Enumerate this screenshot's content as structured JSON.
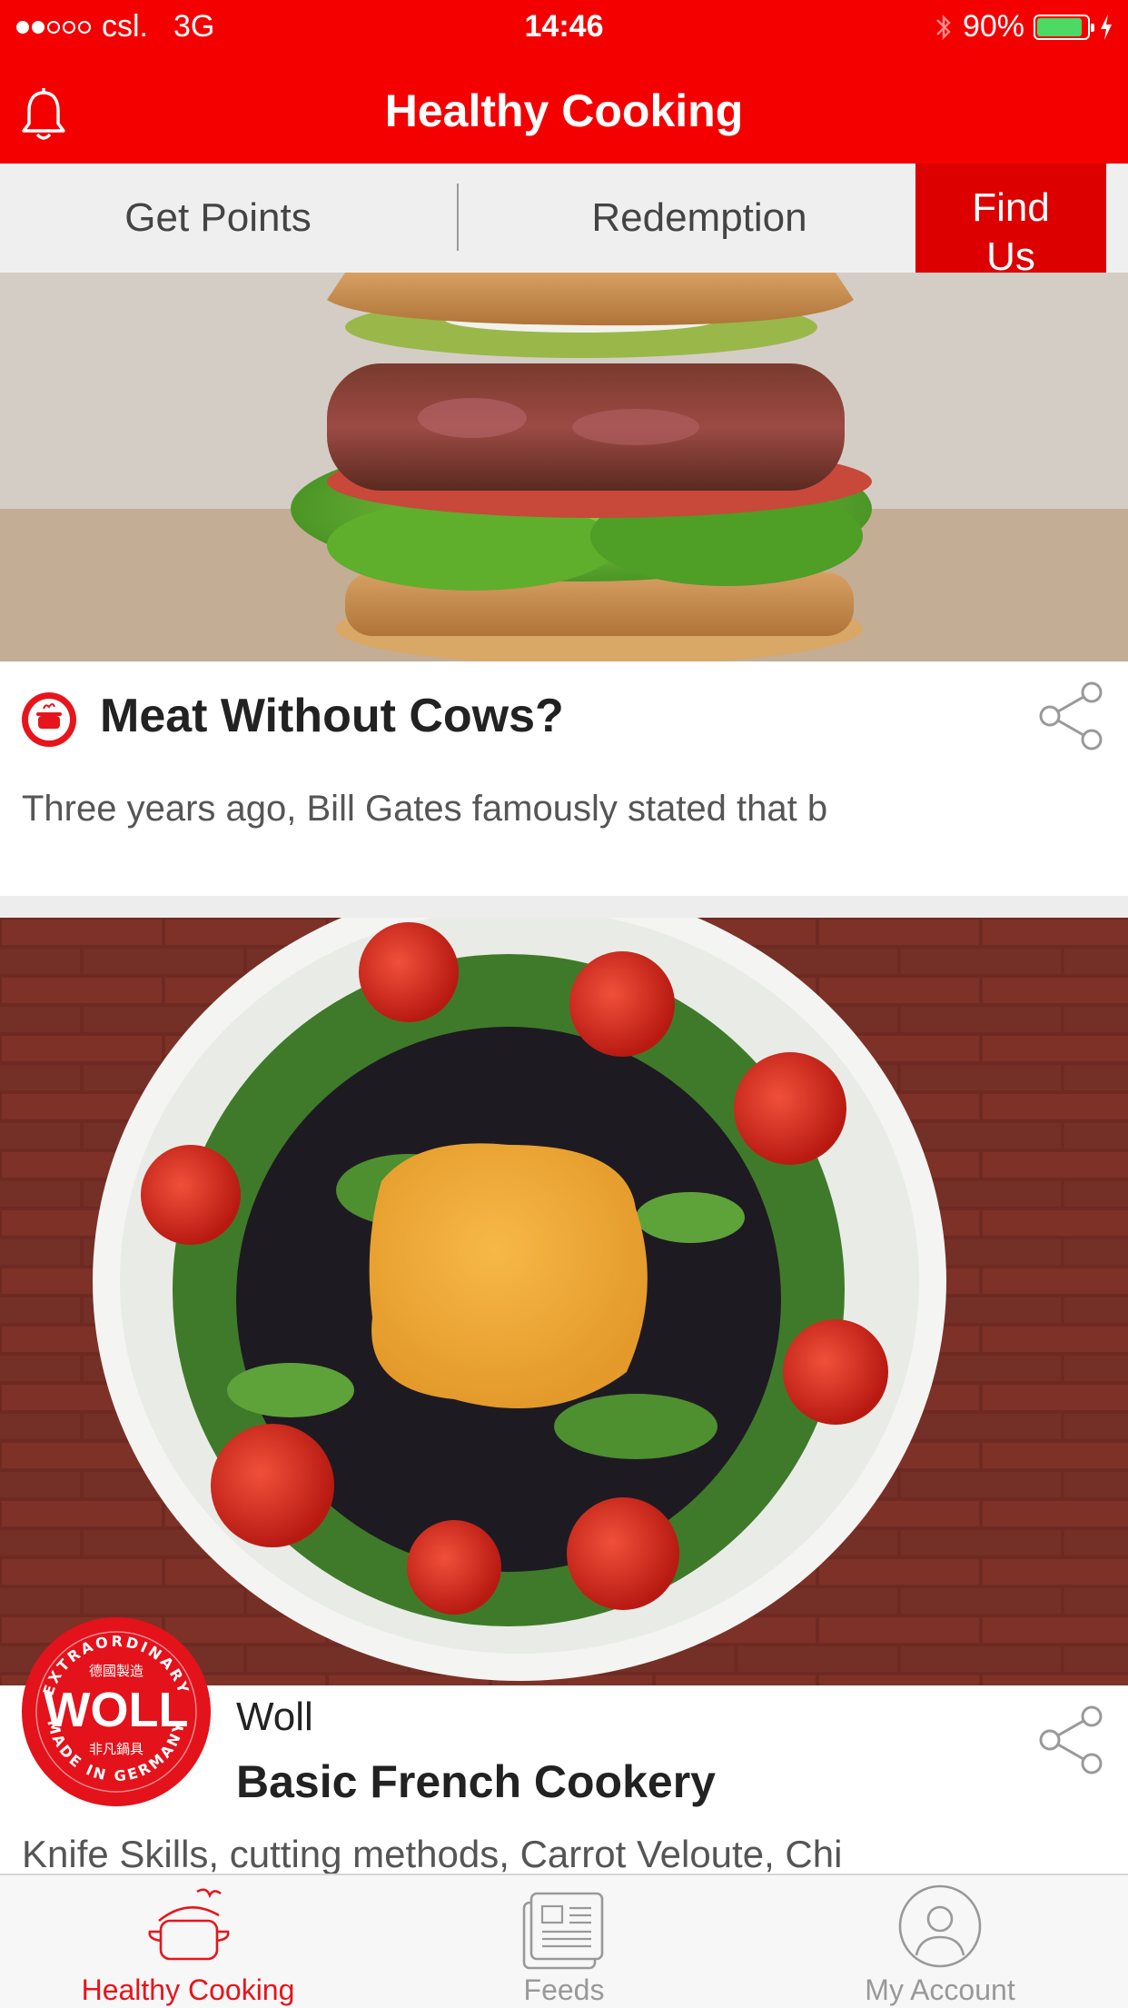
{
  "status_bar": {
    "carrier": "csl.",
    "network": "3G",
    "time": "14:46",
    "battery": "90%",
    "battery_level": 0.9,
    "signal_bars": 2
  },
  "nav": {
    "title": "Healthy Cooking",
    "bell_icon": "bell-icon"
  },
  "segments": {
    "get_points": "Get Points",
    "redemption": "Redemption",
    "find_us": "Find\nUs"
  },
  "cards": [
    {
      "title": "Meat Without Cows?",
      "excerpt": "Three years ago, Bill Gates famously stated that b",
      "image": "burger-photo",
      "badge_icon": "cooking-pot-badge-icon",
      "share_icon": "share-icon"
    },
    {
      "author": "Woll",
      "title": "Basic French Cookery",
      "excerpt": "Knife Skills, cutting methods, Carrot Veloute, Chi",
      "image": "salad-bowl-photo",
      "logo": {
        "top_arc": "EXTRAORDINARY",
        "top_chinese": "德國製造",
        "brand": "WOLL",
        "bottom_chinese": "非凡鍋具",
        "bottom_arc": "MADE IN GERMANY"
      },
      "share_icon": "share-icon"
    }
  ],
  "tabs": [
    {
      "label": "Healthy Cooking",
      "icon": "cooking-pot-icon",
      "active": true
    },
    {
      "label": "Feeds",
      "icon": "newspaper-icon",
      "active": false
    },
    {
      "label": "My Account",
      "icon": "user-icon",
      "active": false
    }
  ],
  "colors": {
    "brand_red": "#f40000",
    "accent_red": "#dd0000",
    "tab_active": "#e8141b",
    "tab_inactive": "#999999"
  }
}
